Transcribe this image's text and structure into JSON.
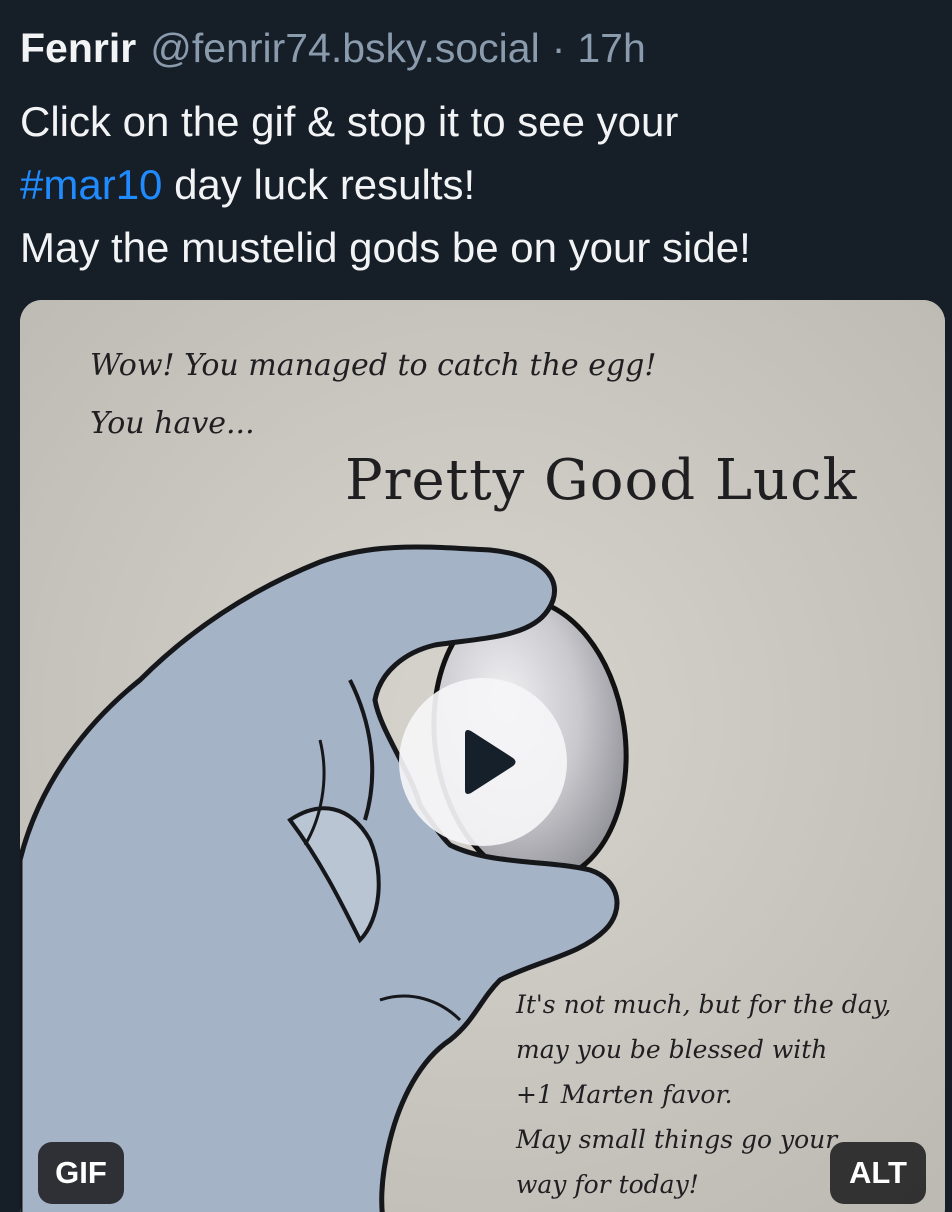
{
  "post": {
    "author": {
      "display_name": "Fenrir",
      "handle": "@fenrir74.bsky.social"
    },
    "separator": "·",
    "timestamp": "17h",
    "text": {
      "line1": "Click on the gif & stop it to see your",
      "hashtag": "#mar10",
      "line2_rest": " day luck results!",
      "line3": "May the mustelid gods be on your side!"
    }
  },
  "media": {
    "type": "gif",
    "caption_top_1": "Wow! You managed to catch the egg!",
    "caption_top_2": "You have...",
    "luck_title": "Pretty Good Luck",
    "caption_bottom": [
      "It's not much, but for the day,",
      "may you be blessed with",
      "+1 Marten favor.",
      "May small things go your",
      "way for today!"
    ],
    "play_icon": "play-icon",
    "gif_badge": "GIF",
    "alt_badge": "ALT"
  },
  "colors": {
    "background": "#161e27",
    "text": "#f1f3f5",
    "muted": "#8a9bad",
    "link": "#208bfe"
  }
}
